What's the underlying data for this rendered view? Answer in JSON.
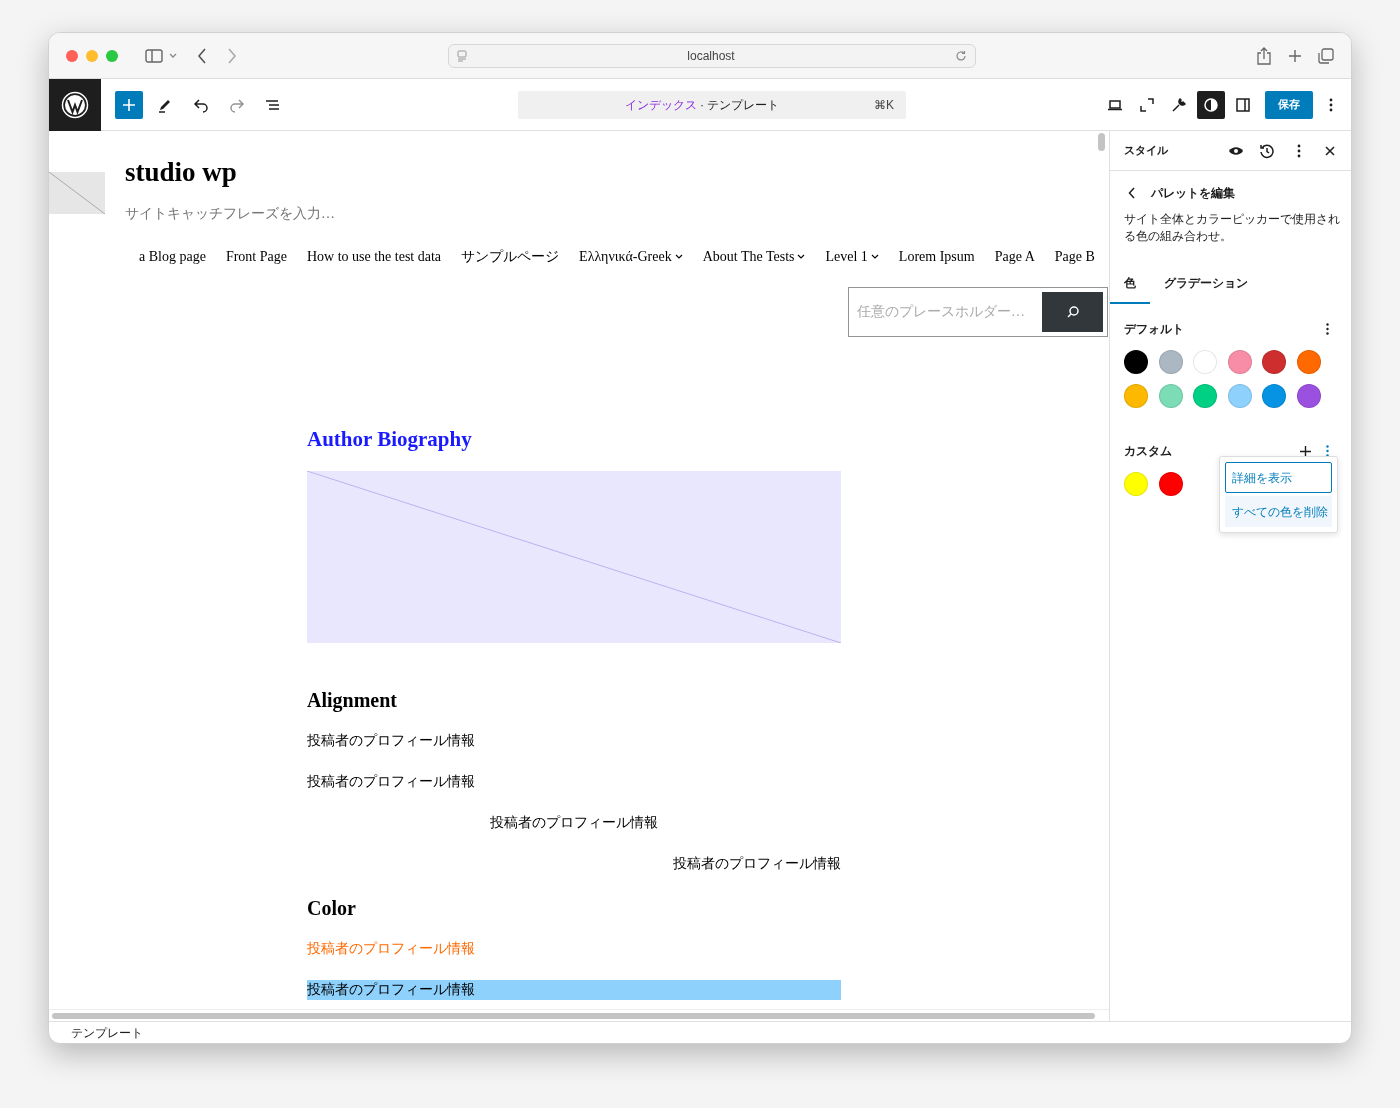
{
  "browser": {
    "url": "localhost"
  },
  "toolbar": {
    "left_tools": [
      {
        "kind": "add",
        "active": true
      },
      {
        "kind": "edit",
        "active": false
      },
      {
        "kind": "undo",
        "active": false
      },
      {
        "kind": "redo",
        "active": false
      },
      {
        "kind": "list",
        "active": false
      }
    ],
    "command": {
      "primary": "インデックス",
      "secondary": "· テンプレート",
      "shortcut": "⌘K"
    },
    "right_tools": [
      {
        "kind": "view",
        "active": false
      },
      {
        "kind": "fullscreen",
        "active": false
      },
      {
        "kind": "tools",
        "active": false
      },
      {
        "kind": "styles",
        "active": true
      },
      {
        "kind": "sidebar",
        "active": false
      }
    ],
    "save": "保存"
  },
  "canvas": {
    "site_title": "studio wp",
    "tagline": "サイトキャッチフレーズを入力…",
    "nav": [
      {
        "label": "a Blog page",
        "has_submenu": false
      },
      {
        "label": "Front Page",
        "has_submenu": false
      },
      {
        "label": "How to use the test data",
        "has_submenu": false
      },
      {
        "label": "サンプルページ",
        "has_submenu": false
      },
      {
        "label": "Ελληνικά-Greek",
        "has_submenu": true
      },
      {
        "label": "About The Tests",
        "has_submenu": true
      },
      {
        "label": "Level 1",
        "has_submenu": true
      },
      {
        "label": "Lorem Ipsum",
        "has_submenu": false
      },
      {
        "label": "Page A",
        "has_submenu": false
      },
      {
        "label": "Page B",
        "has_submenu": false
      }
    ],
    "search": {
      "placeholder": "任意のプレースホルダー…"
    },
    "title": "Author Biography",
    "blocks": [
      {
        "kind": "heading",
        "text": "Alignment"
      },
      {
        "kind": "paragraph",
        "text": "投稿者のプロフィール情報"
      },
      {
        "kind": "paragraph",
        "text": "投稿者のプロフィール情報"
      },
      {
        "kind": "centered",
        "text": "投稿者のプロフィール情報"
      },
      {
        "kind": "right",
        "text": "投稿者のプロフィール情報"
      },
      {
        "kind": "heading",
        "text": "Color"
      },
      {
        "kind": "paragraph",
        "text": "投稿者のプロフィール情報",
        "color": "#ff6900"
      },
      {
        "kind": "highlighted",
        "text": "投稿者のプロフィール情報",
        "color": "#8ed1fc"
      }
    ]
  },
  "sidebar": {
    "title": "スタイル",
    "back": "パレットを編集",
    "description": "サイト全体とカラーピッカーで使用される色の組み合わせ。",
    "tabs": [
      {
        "label": "色",
        "selected": true
      },
      {
        "label": "グラデーション",
        "selected": false
      }
    ],
    "palettes": [
      {
        "label": "デフォルト",
        "colors": [
          {
            "color": "#000000"
          },
          {
            "color": "#abb8c3"
          },
          {
            "color": "#ffffff"
          },
          {
            "color": "#f78da7"
          },
          {
            "color": "#cf2e2e"
          },
          {
            "color": "#ff6900"
          },
          {
            "color": "#fcb900"
          },
          {
            "color": "#7bdcb5"
          },
          {
            "color": "#00d084"
          },
          {
            "color": "#8ed1fc"
          },
          {
            "color": "#0693e3"
          },
          {
            "color": "#9b51e0"
          }
        ]
      },
      {
        "label": "カスタム",
        "can_add": true,
        "colors": [
          {
            "color": "#ffff00"
          },
          {
            "color": "#ff0000"
          }
        ]
      }
    ],
    "menu": [
      {
        "label": "詳細を表示",
        "focused": true
      },
      {
        "label": "すべての色を削除",
        "focused": false
      }
    ]
  },
  "footer": "テンプレート"
}
